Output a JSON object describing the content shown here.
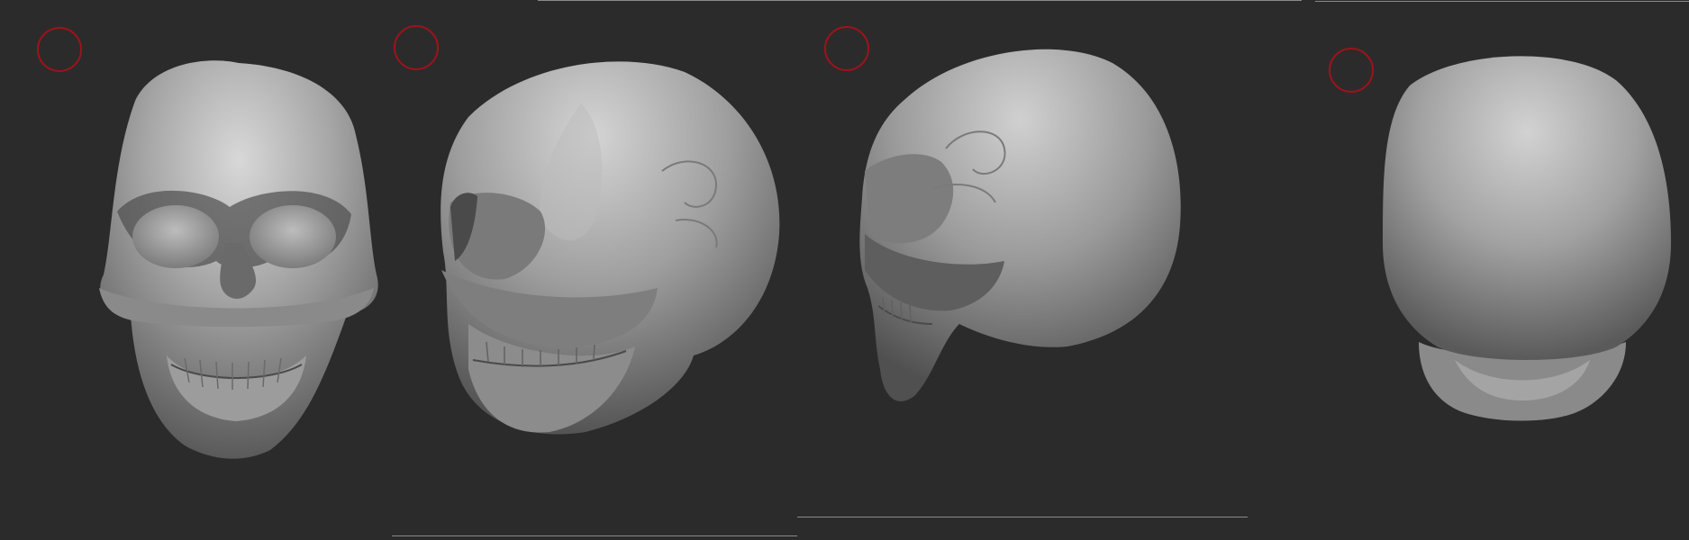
{
  "viewport": {
    "background": "#2b2b2b",
    "surface_color": "#8f8f8f",
    "highlight_color": "#d6d6d6",
    "shadow_color": "#3a3a3a",
    "gizmo_color": "#a0121a"
  },
  "views": [
    {
      "name": "front",
      "gizmo_icon": "view-orientation-icon"
    },
    {
      "name": "three-quarter",
      "gizmo_icon": "view-orientation-icon"
    },
    {
      "name": "side",
      "gizmo_icon": "view-orientation-icon"
    },
    {
      "name": "back",
      "gizmo_icon": "view-orientation-icon"
    }
  ]
}
